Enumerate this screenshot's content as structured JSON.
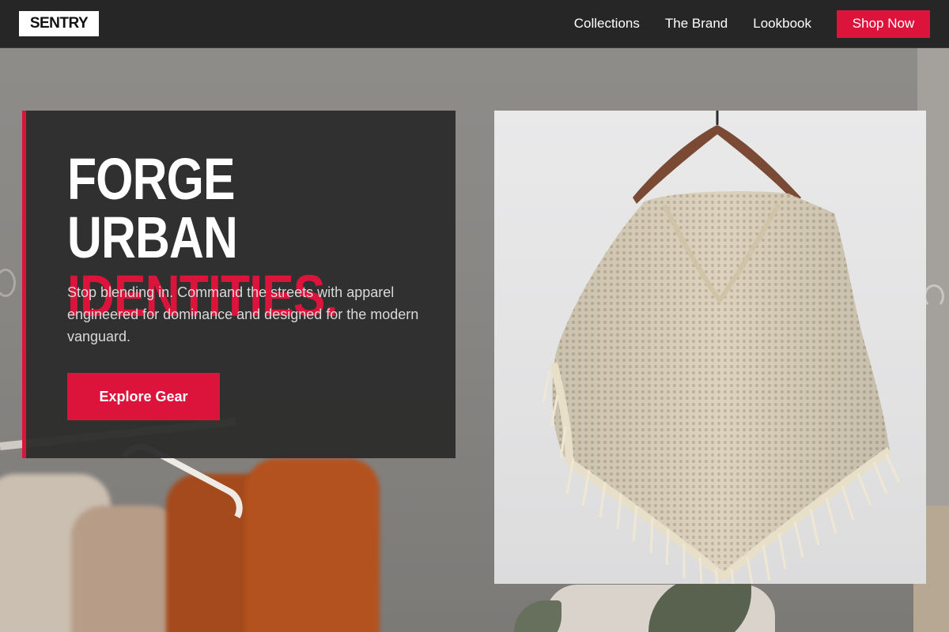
{
  "brand": {
    "logo_text": "SENTRY"
  },
  "nav": {
    "links": [
      "Collections",
      "The Brand",
      "Lookbook"
    ],
    "cta_label": "Shop Now"
  },
  "hero": {
    "headline_line1": "FORGE URBAN",
    "headline_line2": "IDENTITIES.",
    "description": "Stop blending in. Command the streets with apparel engineered for dominance and designed for the modern vanguard.",
    "cta_label": "Explore Gear"
  },
  "product_image": {
    "subject": "knit-poncho-on-hanger"
  },
  "colors": {
    "accent": "#dc143c",
    "navbar": "#262626",
    "card": "#2b2b2b",
    "text_light": "#ffffff"
  }
}
